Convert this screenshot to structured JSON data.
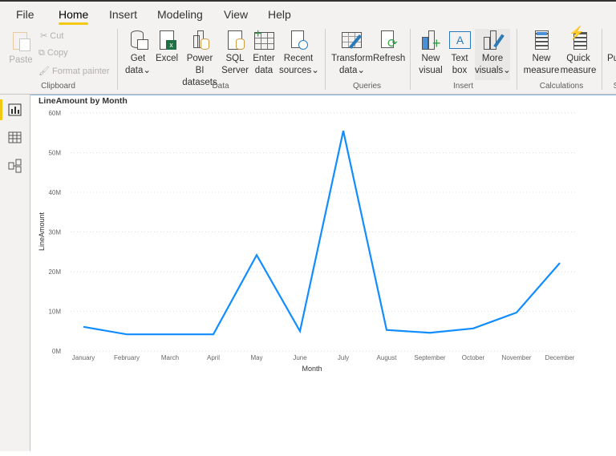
{
  "tabs": [
    "File",
    "Home",
    "Insert",
    "Modeling",
    "View",
    "Help"
  ],
  "active_tab": "Home",
  "clipboard": {
    "paste": "Paste",
    "cut": "Cut",
    "copy": "Copy",
    "format_painter": "Format painter",
    "group": "Clipboard"
  },
  "data_group": {
    "get_data": [
      "Get",
      "data"
    ],
    "excel": "Excel",
    "powerbi": [
      "Power BI",
      "datasets"
    ],
    "sql": [
      "SQL",
      "Server"
    ],
    "enter": [
      "Enter",
      "data"
    ],
    "recent": [
      "Recent",
      "sources"
    ],
    "group": "Data"
  },
  "queries": {
    "transform": [
      "Transform",
      "data"
    ],
    "refresh": "Refresh",
    "group": "Queries"
  },
  "insert": {
    "new_visual": [
      "New",
      "visual"
    ],
    "text_box": [
      "Text",
      "box"
    ],
    "more_visuals": [
      "More",
      "visuals"
    ],
    "group": "Insert"
  },
  "calculations": {
    "new_measure": [
      "New",
      "measure"
    ],
    "quick_measure": [
      "Quick",
      "measure"
    ],
    "group": "Calculations"
  },
  "share": {
    "publish": "Pu",
    "group": "S"
  },
  "accent": "#f2c811",
  "chart_data": {
    "type": "line",
    "title": "LineAmount by Month",
    "xlabel": "Month",
    "ylabel": "LineAmount",
    "categories": [
      "January",
      "February",
      "March",
      "April",
      "May",
      "June",
      "July",
      "August",
      "September",
      "October",
      "November",
      "December"
    ],
    "values": [
      6.1,
      4.2,
      4.2,
      4.2,
      24.2,
      5.0,
      55.5,
      5.3,
      4.6,
      5.7,
      9.7,
      22.2
    ],
    "value_unit": "M",
    "yticks": [
      "0M",
      "10M",
      "20M",
      "30M",
      "40M",
      "50M",
      "60M"
    ],
    "ylim": [
      0,
      60
    ],
    "grid": true,
    "color": "#118dff"
  }
}
